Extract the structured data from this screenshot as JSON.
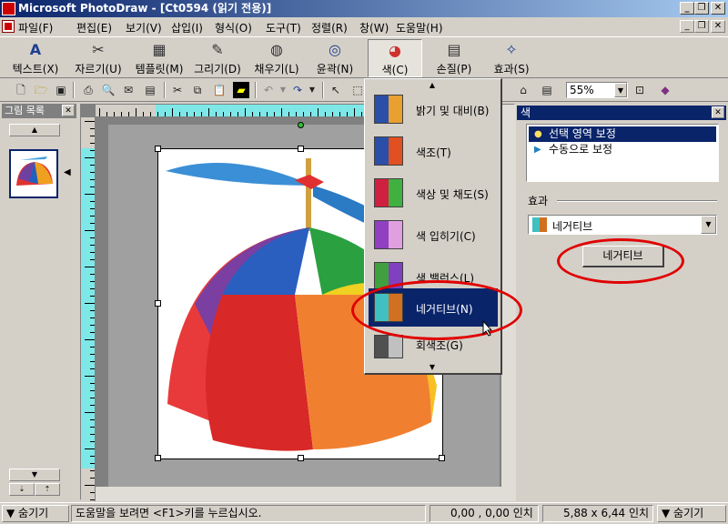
{
  "window": {
    "title": "Microsoft PhotoDraw - [Ct0594 (읽기 전용)]",
    "min": "_",
    "max": "❐",
    "close": "✕"
  },
  "menu": [
    "파일(F)",
    "편집(E)",
    "보기(V)",
    "삽입(I)",
    "형식(O)",
    "도구(T)",
    "정렬(R)",
    "창(W)",
    "도움말(H)"
  ],
  "bigtoolbar": [
    {
      "label": "텍스트(X)",
      "icon": "A"
    },
    {
      "label": "자르기(U)",
      "icon": "✂"
    },
    {
      "label": "템플릿(M)",
      "icon": "▦"
    },
    {
      "label": "그리기(D)",
      "icon": "✎"
    },
    {
      "label": "채우기(L)",
      "icon": "◍"
    },
    {
      "label": "윤곽(N)",
      "icon": "◎"
    },
    {
      "label": "색(C)",
      "icon": "◕"
    },
    {
      "label": "손질(P)",
      "icon": "▤"
    },
    {
      "label": "효과(S)",
      "icon": "✧"
    }
  ],
  "zoom": "55%",
  "leftpanel": {
    "title": "그림 목록",
    "close": "✕",
    "up": "▲",
    "arrow": "◀",
    "down": "▼",
    "top": "⇡",
    "bottom": "⇣"
  },
  "colormenu": {
    "up": "▲",
    "down": "▼",
    "items": [
      {
        "label": "밝기 및 대비(B)",
        "colors": [
          "#2b4fa8",
          "#e8a030"
        ]
      },
      {
        "label": "색조(T)",
        "colors": [
          "#2b4fa8",
          "#e05020"
        ]
      },
      {
        "label": "색상 및 채도(S)",
        "colors": [
          "#d02040",
          "#40b040"
        ]
      },
      {
        "label": "색 입히기(C)",
        "colors": [
          "#9040c0",
          "#e0a0e0"
        ]
      },
      {
        "label": "색 밸런스(L)",
        "colors": [
          "#40a040",
          "#8040c0"
        ]
      },
      {
        "label": "네거티브(N)",
        "colors": [
          "#40c0c0",
          "#d07020"
        ]
      },
      {
        "label": "회색조(G)",
        "colors": [
          "#505050",
          "#c0c0c0"
        ]
      }
    ]
  },
  "rightpanel": {
    "title": "색",
    "close": "✕",
    "options": [
      "선택 영역 보정",
      "수동으로 보정"
    ],
    "effect_label": "효과",
    "effect_value": "네거티브",
    "button_label": "네거티브",
    "dropdown": "▼"
  },
  "status": {
    "hide_left": "▼ 숨기기",
    "help": "도움말을 보려면 <F1>키를 누르십시오.",
    "position": "0,00 , 0,00 인치",
    "size": "5,88 x 6,44 인치",
    "hide_right": "▼ 숨기기"
  },
  "colors": {
    "titlebar": "#0a246a",
    "selection": "#0a246a",
    "annotation": "#e00000",
    "ruler_highlight": "#7ee8e8"
  }
}
